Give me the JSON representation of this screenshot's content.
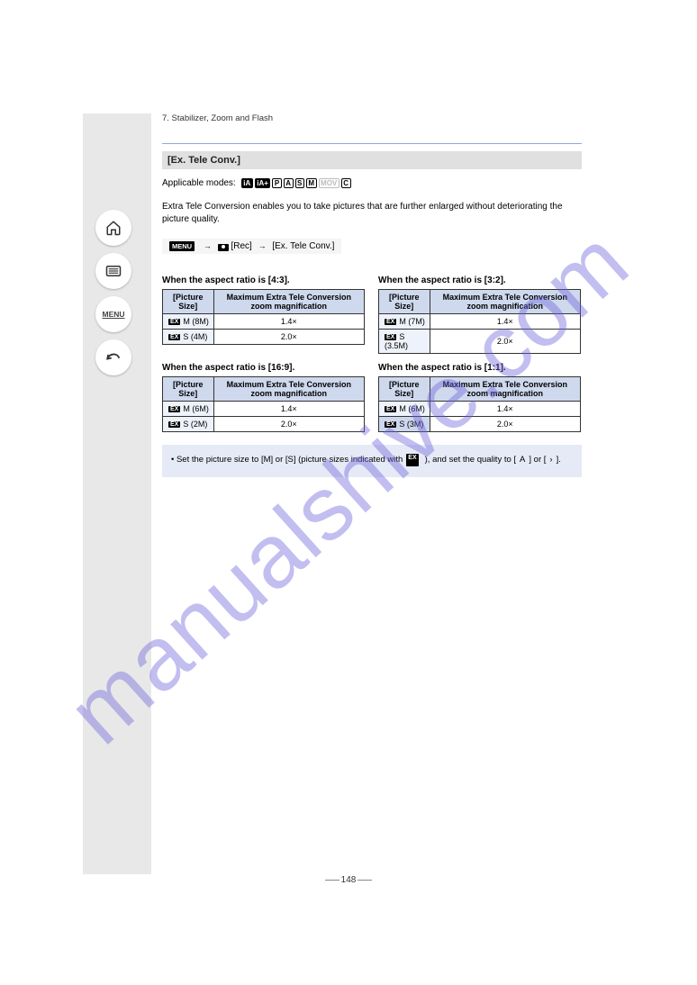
{
  "watermark": "manualshive.com",
  "sidebar": {
    "home_name": "home-icon",
    "list_name": "list-icon",
    "menu_label": "MENU",
    "back_name": "back-icon"
  },
  "breadcrumb": "7. Stabilizer, Zoom and Flash",
  "section_title": "[Ex. Tele Conv.]",
  "modes_label": "Applicable modes:",
  "mode_icons": [
    "iA",
    "iA+",
    "P",
    "A",
    "S",
    "M",
    "MOV",
    "C"
  ],
  "paragraph": "Extra Tele Conversion enables you to take pictures that are further enlarged without deteriorating the picture quality.",
  "menu_path": {
    "menu_chip": "MENU",
    "arrow": "→",
    "rec_label": "[Rec]",
    "arrow2": "→",
    "item_label": "[Ex. Tele Conv.]"
  },
  "aspect_labels": {
    "row1_l": "When the aspect ratio is [4:3].",
    "row1_r": "When the aspect ratio is [3:2].",
    "row2_l": "When the aspect ratio is [16:9].",
    "row2_r": "When the aspect ratio is [1:1]."
  },
  "tables": {
    "header1": "[Picture Size]",
    "header2": "Maximum Extra Tele Conversion zoom magnification",
    "t1": [
      {
        "setting_badge": "EX",
        "setting": "M (8M)",
        "mag": "1.4×"
      },
      {
        "setting_badge": "EX",
        "setting": "S (4M)",
        "mag": "2.0×",
        "hl": true
      }
    ],
    "t2": [
      {
        "setting_badge": "EX",
        "setting": "M (7M)",
        "mag": "1.4×"
      },
      {
        "setting_badge": "EX",
        "setting": "S (3.5M)",
        "mag": "2.0×",
        "hl": true
      }
    ],
    "t3": [
      {
        "setting_badge": "EX",
        "setting": "M (6M)",
        "mag": "1.4×"
      },
      {
        "setting_badge": "EX",
        "setting": "S (2M)",
        "mag": "2.0×",
        "hl": true
      }
    ],
    "t4": [
      {
        "setting_badge": "EX",
        "setting": "M (6M)",
        "mag": "1.4×"
      },
      {
        "setting_badge": "EX",
        "setting": "S (3M)",
        "mag": "2.0×",
        "hl": true
      }
    ]
  },
  "note": {
    "line1_prefix": "• Set the picture size to [M] or [S] (picture sizes indicated with ",
    "line1_chip": "EX",
    "line1_suffix": "), and set the quality to [",
    "line1_end": "] or [",
    "line1_end2": "]."
  },
  "page_number": "148"
}
